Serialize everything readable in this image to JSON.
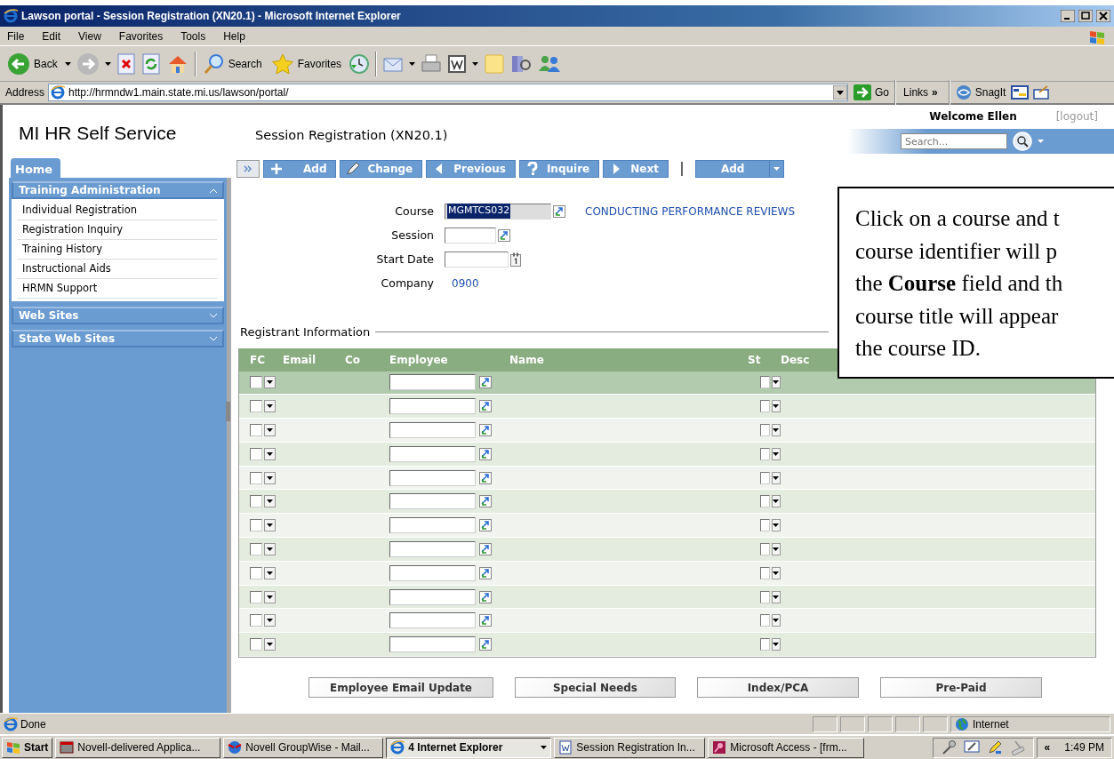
{
  "window": {
    "title": "Lawson portal - Session Registration (XN20.1) - Microsoft Internet Explorer"
  },
  "menu": [
    "File",
    "Edit",
    "View",
    "Favorites",
    "Tools",
    "Help"
  ],
  "toolbar": {
    "back": "Back",
    "search": "Search",
    "favorites": "Favorites"
  },
  "address_bar": {
    "label": "Address",
    "url": "http://hrmndw1.main.state.mi.us/lawson/portal/",
    "go": "Go",
    "links": "Links",
    "links_more": "»",
    "snagit": "SnagIt"
  },
  "portal": {
    "brand": "MI HR Self Service",
    "page_title": "Session Registration (XN20.1)",
    "welcome": "Welcome Ellen",
    "logout": "[logout]",
    "search_placeholder": "Search..."
  },
  "sidebar": {
    "tab": "Home",
    "sections": [
      {
        "title": "Training Administration",
        "expanded": true,
        "items": [
          "Individual Registration",
          "Registration Inquiry",
          "Training History",
          "Instructional Aids",
          "HRMN Support"
        ]
      },
      {
        "title": "Web Sites",
        "expanded": false
      },
      {
        "title": "State Web Sites",
        "expanded": false
      }
    ]
  },
  "form_toolbar": [
    {
      "kind": "add",
      "label": "Add"
    },
    {
      "kind": "change",
      "label": "Change"
    },
    {
      "kind": "previous",
      "label": "Previous"
    },
    {
      "kind": "inquire",
      "label": "Inquire"
    },
    {
      "kind": "next",
      "label": "Next"
    },
    {
      "kind": "split",
      "label": "Add"
    }
  ],
  "fields": [
    {
      "kind": "lookup",
      "label": "Course",
      "value": "MGMTCS032",
      "value_selected": true,
      "description": "CONDUCTING PERFORMANCE REVIEWS"
    },
    {
      "kind": "lookup",
      "label": "Session"
    },
    {
      "kind": "date",
      "label": "Start Date"
    },
    {
      "kind": "text",
      "label": "Company",
      "value": "0900"
    }
  ],
  "registrant": {
    "legend": "Registrant Information",
    "columns": [
      "FC",
      "Email",
      "Co",
      "Employee",
      "Name",
      "St",
      "Desc"
    ],
    "rows": [
      {
        "selected": true
      },
      {
        "selected": false
      },
      {
        "selected": false
      },
      {
        "selected": false
      },
      {
        "selected": false
      },
      {
        "selected": false
      },
      {
        "selected": false
      },
      {
        "selected": false
      },
      {
        "selected": false
      },
      {
        "selected": false
      },
      {
        "selected": false
      },
      {
        "selected": false
      }
    ]
  },
  "callout": {
    "lines": [
      "Click on a course and t",
      "course identifier will p",
      "the **Course** field and th",
      "course title will appear",
      "the course ID."
    ]
  },
  "action_buttons": [
    "Employee Email Update",
    "Special Needs",
    "Index/PCA",
    "Pre-Paid"
  ],
  "status_bar": {
    "text": "Done",
    "zone": "Internet"
  },
  "taskbar": {
    "start": "Start",
    "tasks": [
      {
        "label": "Novell-delivered Applica...",
        "selected": false
      },
      {
        "label": "Novell GroupWise - Mail...",
        "selected": false
      },
      {
        "label": "4 Internet Explorer",
        "selected": true
      },
      {
        "label": "Session Registration In...",
        "selected": false
      },
      {
        "label": "Microsoft Access - [frm...",
        "selected": false
      }
    ],
    "more": "«",
    "clock": "1:49 PM"
  }
}
